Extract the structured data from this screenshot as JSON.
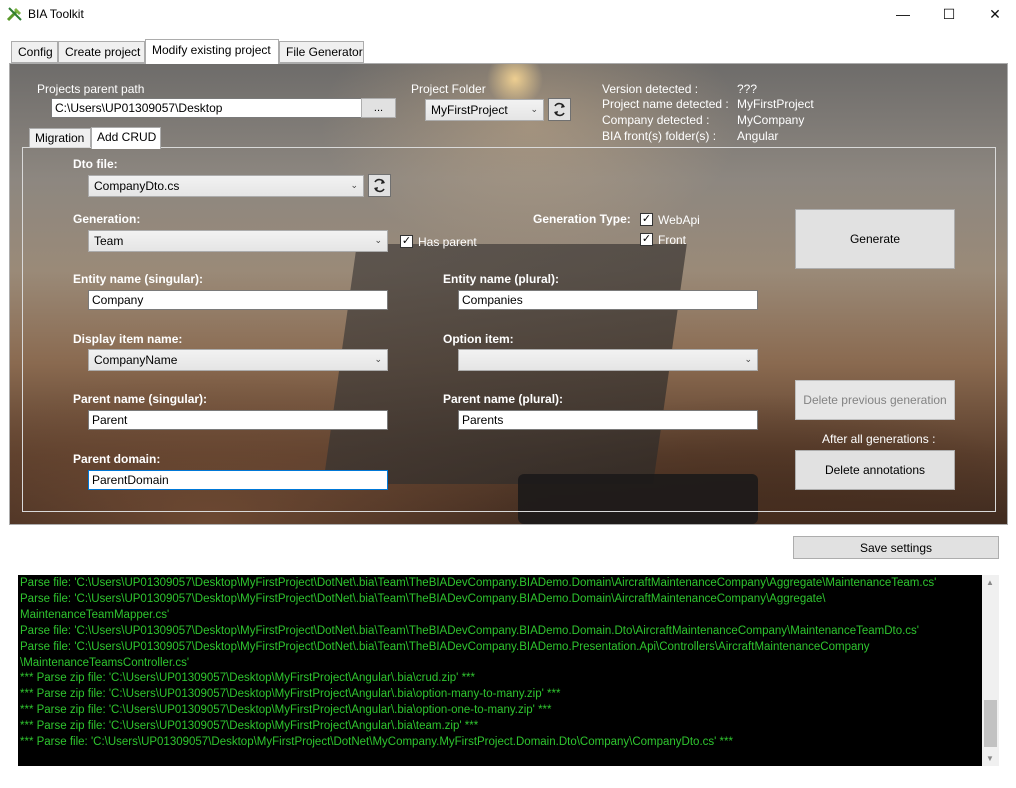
{
  "window": {
    "title": "BIA Toolkit",
    "minimize_glyph": "—",
    "maximize_glyph": "☐",
    "close_glyph": "✕"
  },
  "tabs": [
    {
      "label": "Config"
    },
    {
      "label": "Create project"
    },
    {
      "label": "Modify existing project"
    },
    {
      "label": "File Generator"
    }
  ],
  "project": {
    "parent_path_label": "Projects parent path",
    "parent_path_value": "C:\\Users\\UP01309057\\Desktop",
    "browse_label": "...",
    "folder_label": "Project Folder",
    "folder_value": "MyFirstProject"
  },
  "detected": {
    "version_label": "Version detected :",
    "version_value": "???",
    "project_name_label": "Project name detected :",
    "project_name_value": "MyFirstProject",
    "company_label": "Company detected :",
    "company_value": "MyCompany",
    "front_label": "BIA front(s) folder(s) :",
    "front_value": "Angular"
  },
  "subtabs": [
    {
      "label": "Migration"
    },
    {
      "label": "Add CRUD"
    }
  ],
  "crud": {
    "dto_label": "Dto file:",
    "dto_value": "CompanyDto.cs",
    "generation_label": "Generation:",
    "generation_value": "Team",
    "has_parent_label": "Has parent",
    "has_parent_checked": true,
    "generation_type_label": "Generation Type:",
    "webapi_label": "WebApi",
    "webapi_checked": true,
    "front_label": "Front",
    "front_checked": true,
    "generate_label": "Generate",
    "entity_singular_label": "Entity name (singular):",
    "entity_singular_value": "Company",
    "entity_plural_label": "Entity name (plural):",
    "entity_plural_value": "Companies",
    "display_item_label": "Display item name:",
    "display_item_value": "CompanyName",
    "option_item_label": "Option item:",
    "option_item_value": "",
    "delete_previous_label": "Delete previous generation",
    "parent_singular_label": "Parent name (singular):",
    "parent_singular_value": "Parent",
    "parent_plural_label": "Parent name (plural):",
    "parent_plural_value": "Parents",
    "after_all_label": "After all generations :",
    "parent_domain_label": "Parent domain:",
    "parent_domain_value": "ParentDomain",
    "delete_annotations_label": "Delete annotations"
  },
  "save_settings_label": "Save settings",
  "log_text": "Parse file: 'C:\\Users\\UP01309057\\Desktop\\MyFirstProject\\DotNet\\.bia\\Team\\TheBIADevCompany.BIADemo.Domain\\AircraftMaintenanceCompany\\Aggregate\\MaintenanceTeam.cs'\nParse file: 'C:\\Users\\UP01309057\\Desktop\\MyFirstProject\\DotNet\\.bia\\Team\\TheBIADevCompany.BIADemo.Domain\\AircraftMaintenanceCompany\\Aggregate\\\nMaintenanceTeamMapper.cs'\nParse file: 'C:\\Users\\UP01309057\\Desktop\\MyFirstProject\\DotNet\\.bia\\Team\\TheBIADevCompany.BIADemo.Domain.Dto\\AircraftMaintenanceCompany\\MaintenanceTeamDto.cs'\nParse file: 'C:\\Users\\UP01309057\\Desktop\\MyFirstProject\\DotNet\\.bia\\Team\\TheBIADevCompany.BIADemo.Presentation.Api\\Controllers\\AircraftMaintenanceCompany\n\\MaintenanceTeamsController.cs'\n*** Parse zip file: 'C:\\Users\\UP01309057\\Desktop\\MyFirstProject\\Angular\\.bia\\crud.zip' ***\n*** Parse zip file: 'C:\\Users\\UP01309057\\Desktop\\MyFirstProject\\Angular\\.bia\\option-many-to-many.zip' ***\n*** Parse zip file: 'C:\\Users\\UP01309057\\Desktop\\MyFirstProject\\Angular\\.bia\\option-one-to-many.zip' ***\n*** Parse zip file: 'C:\\Users\\UP01309057\\Desktop\\MyFirstProject\\Angular\\.bia\\team.zip' ***\n*** Parse file: 'C:\\Users\\UP01309057\\Desktop\\MyFirstProject\\DotNet\\MyCompany.MyFirstProject.Domain.Dto\\Company\\CompanyDto.cs' ***",
  "colors": {
    "log_text": "#2fc52f",
    "log_background": "#000000",
    "focus_border": "#0078d7"
  }
}
